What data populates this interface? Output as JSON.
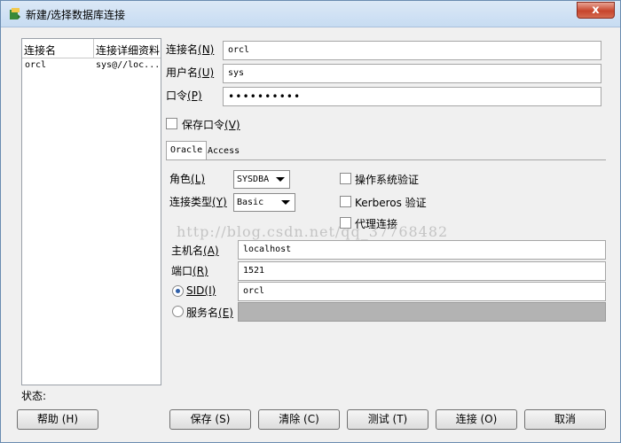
{
  "window": {
    "title": "新建/选择数据库连接",
    "close_label": "x"
  },
  "conn_list": {
    "headers": [
      "连接名",
      "连接详细资料"
    ],
    "rows": [
      {
        "name": "orcl",
        "detail": "sys@//loc..."
      }
    ]
  },
  "form": {
    "conn_name": {
      "label": "连接名",
      "mnemonic": "(N)",
      "value": "orcl"
    },
    "username": {
      "label": "用户名",
      "mnemonic": "(U)",
      "value": "sys"
    },
    "password": {
      "label": "口令",
      "mnemonic": "(P)",
      "value": "••••••••••"
    },
    "save_password": {
      "label": "保存口令",
      "mnemonic": "(V)",
      "checked": false
    }
  },
  "tabs": {
    "oracle": "Oracle",
    "access": "Access"
  },
  "oracle": {
    "role": {
      "label": "角色",
      "mnemonic": "(L)",
      "value": "SYSDBA"
    },
    "conn_type": {
      "label": "连接类型",
      "mnemonic": "(Y)",
      "value": "Basic"
    },
    "os_auth": {
      "label": "操作系统验证",
      "checked": false
    },
    "kerberos": {
      "label": "Kerberos 验证",
      "checked": false
    },
    "proxy": {
      "label": "代理连接",
      "checked": false
    },
    "host": {
      "label": "主机名",
      "mnemonic": "(A)",
      "value": "localhost"
    },
    "port": {
      "label": "端口",
      "mnemonic": "(R)",
      "value": "1521"
    },
    "sid": {
      "label": "SID",
      "mnemonic": "(I)",
      "value": "orcl",
      "selected": true
    },
    "service": {
      "label": "服务名",
      "mnemonic": "(E)",
      "value": "",
      "selected": false
    }
  },
  "status": {
    "label": "状态:"
  },
  "buttons": {
    "help": "帮助 (H)",
    "save": "保存 (S)",
    "clear": "清除 (C)",
    "test": "测试 (T)",
    "connect": "连接 (O)",
    "cancel": "取消"
  },
  "watermark": "http://blog.csdn.net/qq_37768482",
  "colors": {
    "titlebar": "#c7dcf2",
    "close_button": "#c7452d",
    "disabled_field": "#b3b3b3"
  }
}
